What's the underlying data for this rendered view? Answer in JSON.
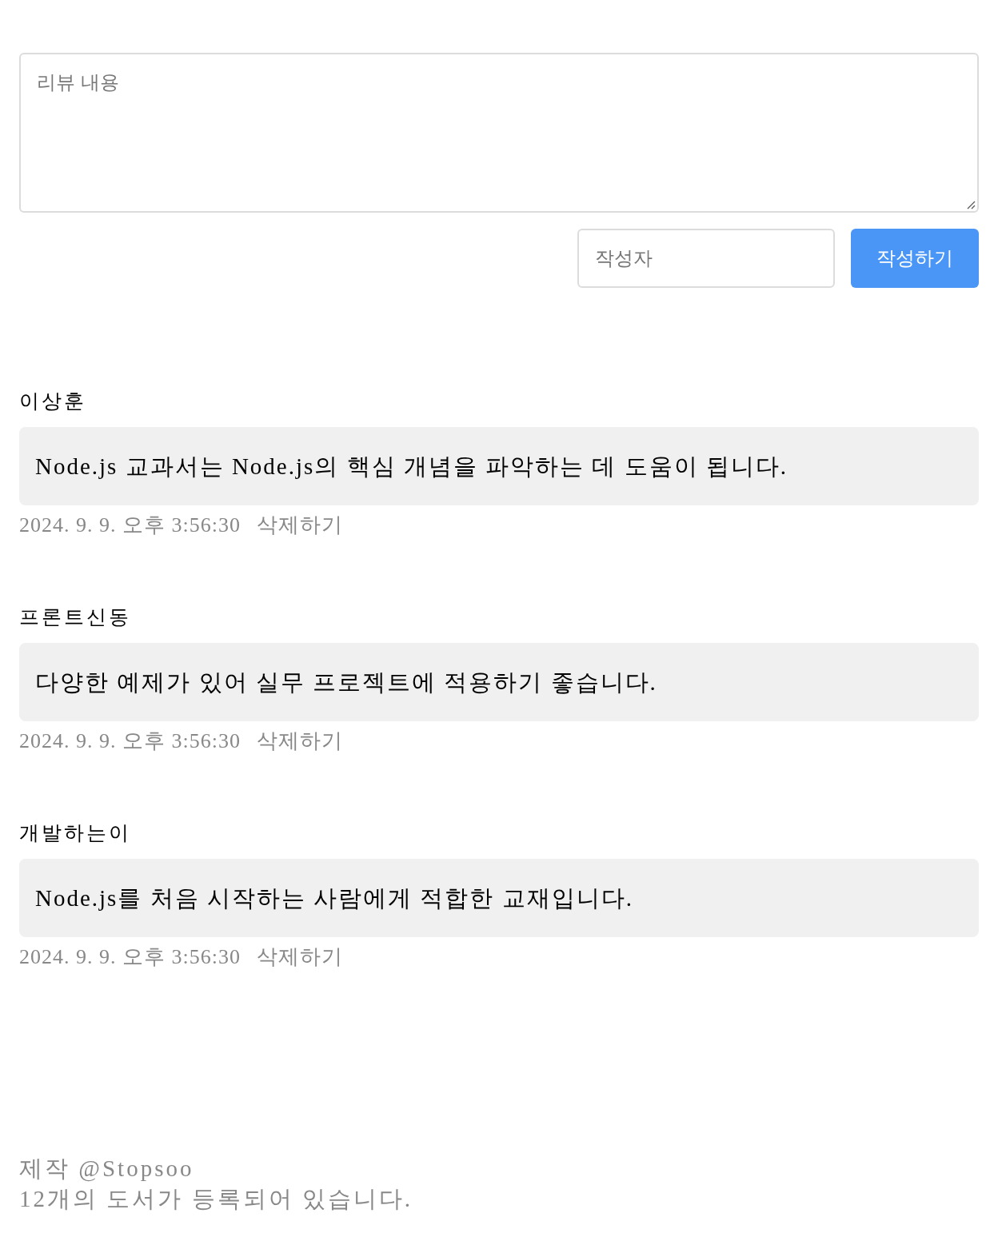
{
  "review_form": {
    "content_field": {
      "placeholder": "리뷰 내용"
    },
    "author_field": {
      "placeholder": "작성자"
    },
    "submit_button": "작성하기"
  },
  "reviews": [
    {
      "author": "이상훈",
      "content": "Node.js 교과서는 Node.js의 핵심 개념을 파악하는 데 도움이 됩니다.",
      "date": "2024. 9. 9. 오후 3:56:30",
      "delete_button": "삭제하기"
    },
    {
      "author": "프론트신동",
      "content": "다양한 예제가 있어 실무 프로젝트에 적용하기 좋습니다.",
      "date": "2024. 9. 9. 오후 3:56:30",
      "delete_button": "삭제하기"
    },
    {
      "author": "개발하는이",
      "content": "Node.js를 처음 시작하는 사람에게 적합한 교재입니다.",
      "date": "2024. 9. 9. 오후 3:56:30",
      "delete_button": "삭제하기"
    }
  ],
  "footer": {
    "credit": "제작 @Stopsoo",
    "book_count": "12개의 도서가 등록되어 있습니다."
  }
}
